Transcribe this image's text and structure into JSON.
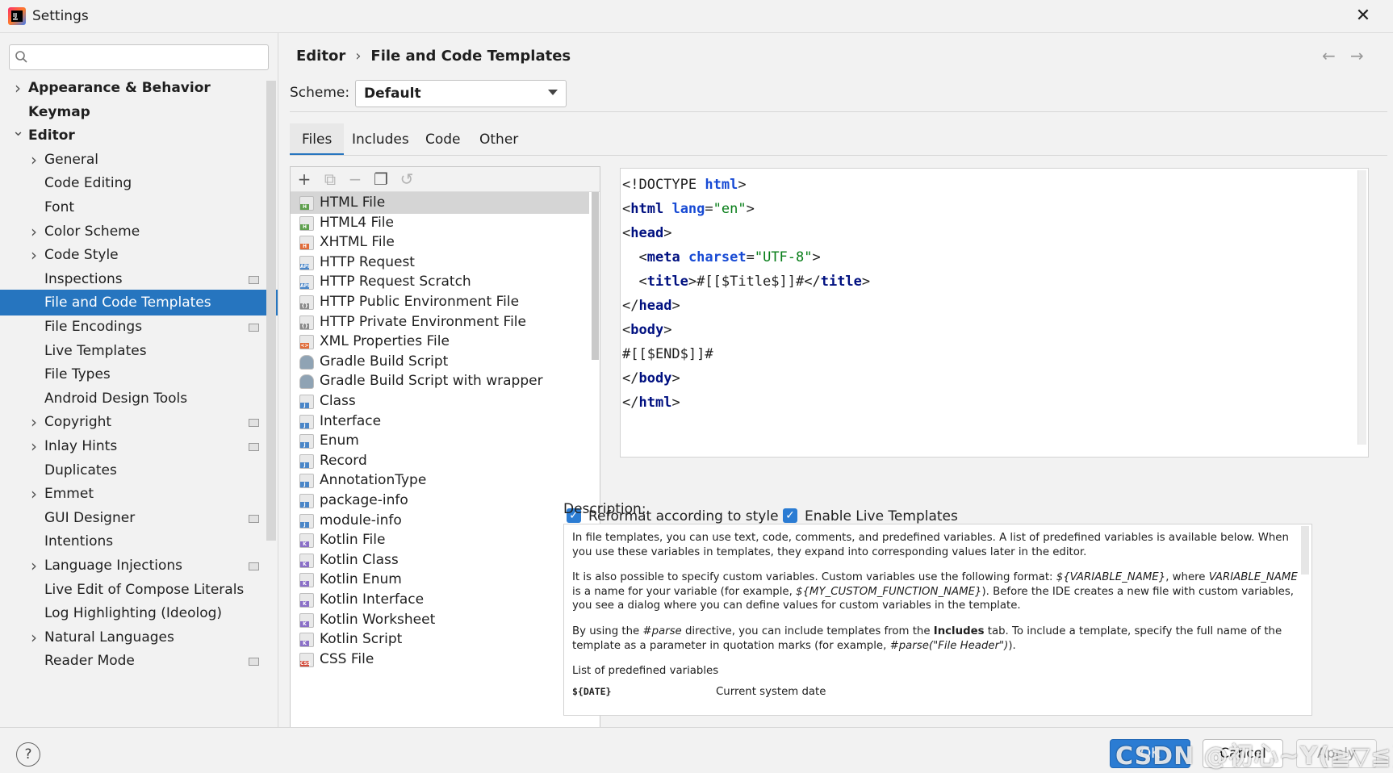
{
  "window": {
    "title": "Settings",
    "close_symbol": "✕"
  },
  "sidebar": {
    "search_value": "",
    "items": [
      {
        "label": "Appearance & Behavior",
        "expander": "right"
      },
      {
        "label": "Keymap",
        "expander": "none"
      },
      {
        "label": "Editor",
        "expander": "down"
      },
      {
        "label": "General",
        "expander": "right"
      },
      {
        "label": "Code Editing",
        "expander": "none"
      },
      {
        "label": "Font",
        "expander": "none"
      },
      {
        "label": "Color Scheme",
        "expander": "right"
      },
      {
        "label": "Code Style",
        "expander": "right"
      },
      {
        "label": "Inspections",
        "expander": "none"
      },
      {
        "label": "File and Code Templates",
        "expander": "none"
      },
      {
        "label": "File Encodings",
        "expander": "none"
      },
      {
        "label": "Live Templates",
        "expander": "none"
      },
      {
        "label": "File Types",
        "expander": "none"
      },
      {
        "label": "Android Design Tools",
        "expander": "none"
      },
      {
        "label": "Copyright",
        "expander": "right"
      },
      {
        "label": "Inlay Hints",
        "expander": "right"
      },
      {
        "label": "Duplicates",
        "expander": "none"
      },
      {
        "label": "Emmet",
        "expander": "right"
      },
      {
        "label": "GUI Designer",
        "expander": "none"
      },
      {
        "label": "Intentions",
        "expander": "none"
      },
      {
        "label": "Language Injections",
        "expander": "right"
      },
      {
        "label": "Live Edit of Compose Literals",
        "expander": "none"
      },
      {
        "label": "Log Highlighting (Ideolog)",
        "expander": "none"
      },
      {
        "label": "Natural Languages",
        "expander": "right"
      },
      {
        "label": "Reader Mode",
        "expander": "none"
      }
    ]
  },
  "breadcrumb": {
    "parent": "Editor",
    "separator": "›",
    "current": "File and Code Templates"
  },
  "nav": {
    "back": "←",
    "forward": "→"
  },
  "scheme": {
    "label": "Scheme:",
    "value": "Default"
  },
  "tabs": [
    "Files",
    "Includes",
    "Code",
    "Other"
  ],
  "toolbar": {
    "add": "+",
    "copy_add": "⧉",
    "remove": "−",
    "copy": "❐",
    "reset": "↺"
  },
  "templates": [
    {
      "label": "HTML File",
      "icon": "html"
    },
    {
      "label": "HTML4 File",
      "icon": "html"
    },
    {
      "label": "XHTML File",
      "icon": "xhtml"
    },
    {
      "label": "HTTP Request",
      "icon": "api"
    },
    {
      "label": "HTTP Request Scratch",
      "icon": "api"
    },
    {
      "label": "HTTP Public Environment File",
      "icon": "env"
    },
    {
      "label": "HTTP Private Environment File",
      "icon": "env"
    },
    {
      "label": "XML Properties File",
      "icon": "xml"
    },
    {
      "label": "Gradle Build Script",
      "icon": "gradle"
    },
    {
      "label": "Gradle Build Script with wrapper",
      "icon": "gradle"
    },
    {
      "label": "Class",
      "icon": "java"
    },
    {
      "label": "Interface",
      "icon": "java"
    },
    {
      "label": "Enum",
      "icon": "java"
    },
    {
      "label": "Record",
      "icon": "java"
    },
    {
      "label": "AnnotationType",
      "icon": "java"
    },
    {
      "label": "package-info",
      "icon": "java"
    },
    {
      "label": "module-info",
      "icon": "java"
    },
    {
      "label": "Kotlin File",
      "icon": "kotlin"
    },
    {
      "label": "Kotlin Class",
      "icon": "kotlin"
    },
    {
      "label": "Kotlin Enum",
      "icon": "kotlin"
    },
    {
      "label": "Kotlin Interface",
      "icon": "kotlin"
    },
    {
      "label": "Kotlin Worksheet",
      "icon": "kotlin"
    },
    {
      "label": "Kotlin Script",
      "icon": "kotlin"
    },
    {
      "label": "CSS File",
      "icon": "css"
    }
  ],
  "icon_colors": {
    "html": "#5fa04e",
    "xhtml": "#e06c3a",
    "api": "#4a86c8",
    "env": "#8a8a8a",
    "xml": "#e06c3a",
    "gradle": "#8fa3b4",
    "java": "#4a86c8",
    "kotlin": "#8a6fc7",
    "css": "#d24a3a"
  },
  "icon_tags": {
    "html": "H",
    "xhtml": "H",
    "api": "API",
    "env": "{}",
    "xml": "<>",
    "gradle": "",
    "java": "J",
    "kotlin": "K",
    "css": "CSS"
  },
  "code_lines": [
    "<!DOCTYPE html>",
    "<html lang=\"en\">",
    "<head>",
    "  <meta charset=\"UTF-8\">",
    "  <title>#[[$Title$]]#</title>",
    "</head>",
    "<body>",
    "#[[$END$]]#",
    "</body>",
    "</html>"
  ],
  "options": {
    "reformat": {
      "label": "Reformat according to style",
      "checked": true
    },
    "live_templates": {
      "label": "Enable Live Templates",
      "checked": true
    }
  },
  "description": {
    "label": "Description:",
    "p1": "In file templates, you can use text, code, comments, and predefined variables. A list of predefined variables is available below. When you use these variables in templates, they expand into corresponding values later in the editor.",
    "p2a": "It is also possible to specify custom variables. Custom variables use the following format: ",
    "p2b": "${VARIABLE_NAME}",
    "p2c": ", where ",
    "p2d": "VARIABLE_NAME",
    "p2e": " is a name for your variable (for example, ",
    "p2f": "${MY_CUSTOM_FUNCTION_NAME}",
    "p2g": "). Before the IDE creates a new file with custom variables, you see a dialog where you can define values for custom variables in the template.",
    "p3a": "By using the ",
    "p3b": "#parse",
    "p3c": " directive, you can include templates from the ",
    "p3d": "Includes",
    "p3e": " tab. To include a template, specify the full name of the template as a parameter in quotation marks (for example, ",
    "p3f": "#parse(\"File Header\")",
    "p3g": ").",
    "list_title": "List of predefined variables",
    "variables": [
      {
        "name": "${DATE}",
        "desc": "Current system date"
      }
    ]
  },
  "footer": {
    "help": "?",
    "ok": "OK",
    "cancel": "Cancel",
    "apply": "Apply",
    "watermark": "CSDN @初心~Y(≧▽≦)"
  }
}
